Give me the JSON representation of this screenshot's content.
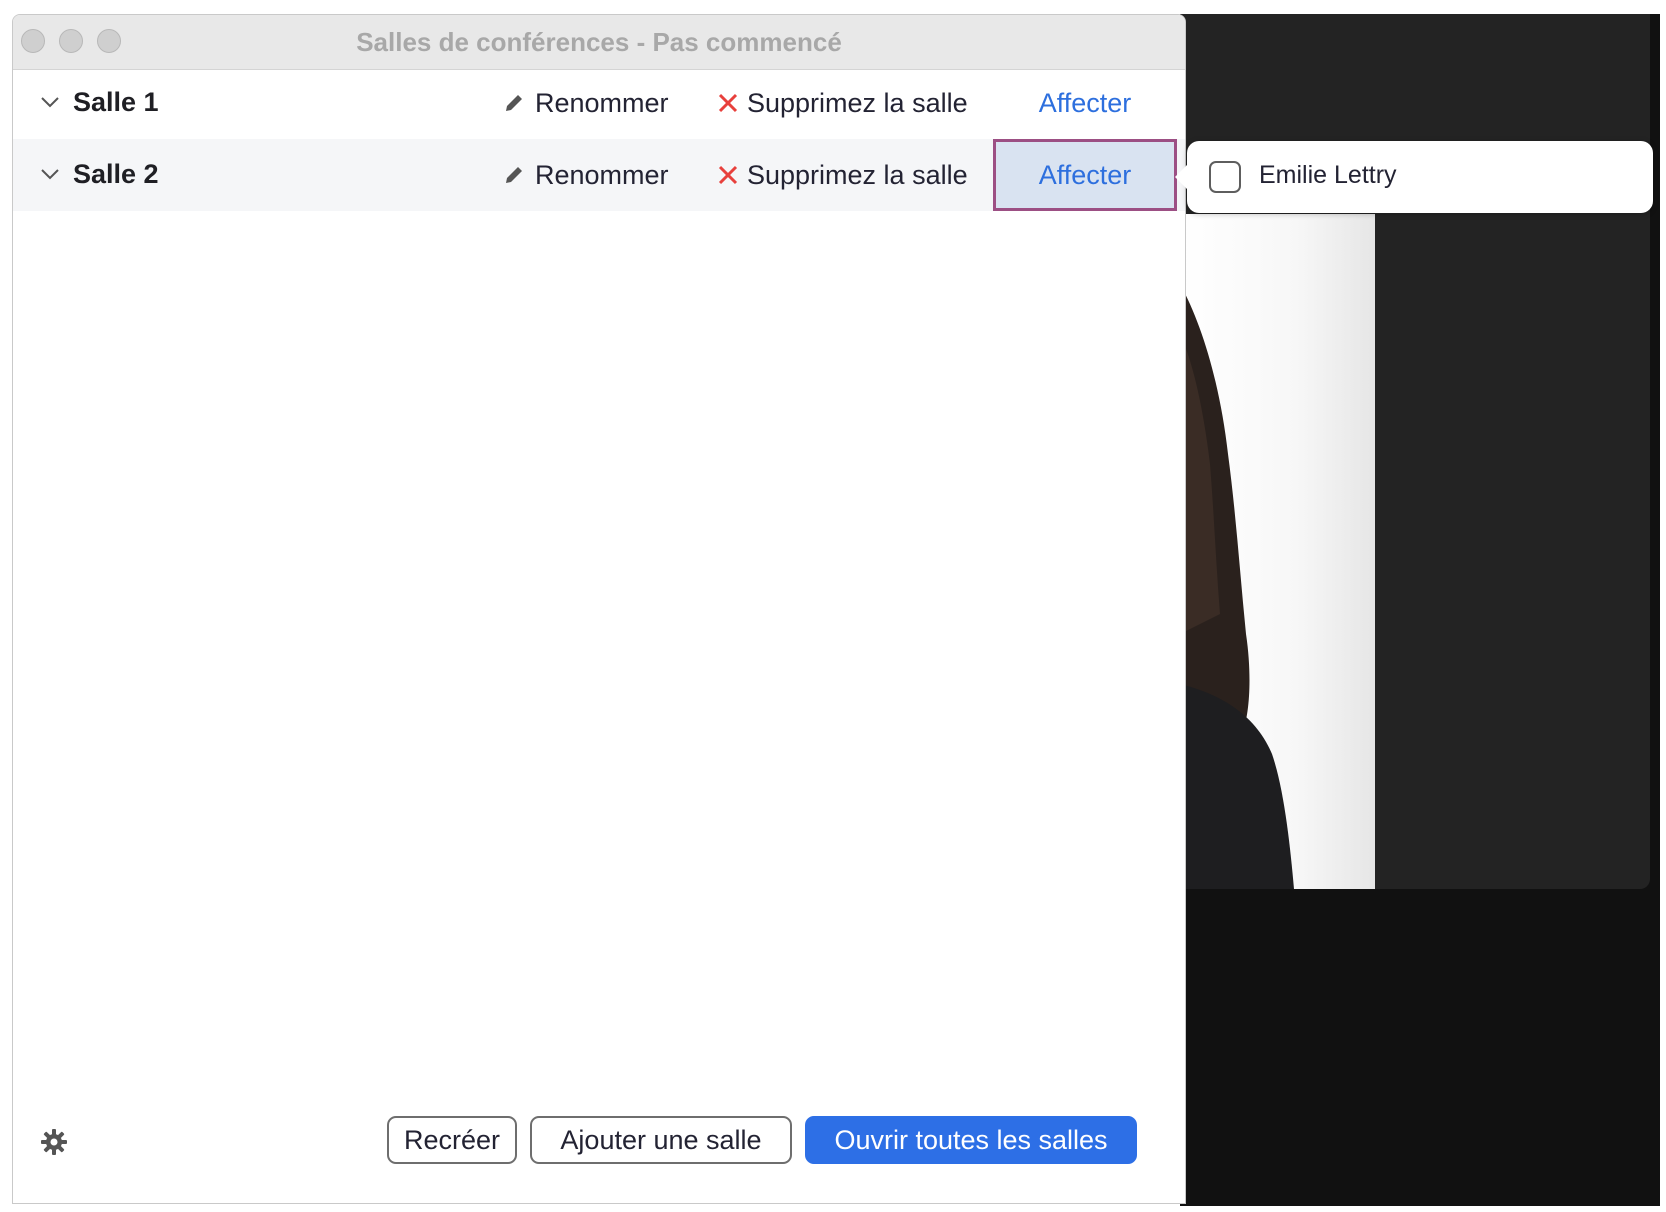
{
  "window": {
    "title": "Salles de conférences - Pas commencé"
  },
  "rooms": [
    {
      "name": "Salle 1",
      "rename_label": "Renommer",
      "delete_label": "Supprimez la salle",
      "assign_label": "Affecter"
    },
    {
      "name": "Salle 2",
      "rename_label": "Renommer",
      "delete_label": "Supprimez la salle",
      "assign_label": "Affecter"
    }
  ],
  "assign_popover": {
    "participants": [
      {
        "name": "Emilie Lettry",
        "checked": false
      }
    ]
  },
  "footer": {
    "recreate_label": "Recréer",
    "add_room_label": "Ajouter une salle",
    "open_all_label": "Ouvrir toutes les salles"
  },
  "icons": {
    "settings": "gear-icon",
    "rename": "pencil-icon",
    "delete": "close-x-icon",
    "expand": "chevron-down-icon"
  },
  "colors": {
    "link_blue": "#2d6fde",
    "primary_button": "#2d6fe6",
    "delete_red": "#e8403c",
    "active_highlight_border": "#9c4f84",
    "active_highlight_fill": "#d9e3f1"
  }
}
